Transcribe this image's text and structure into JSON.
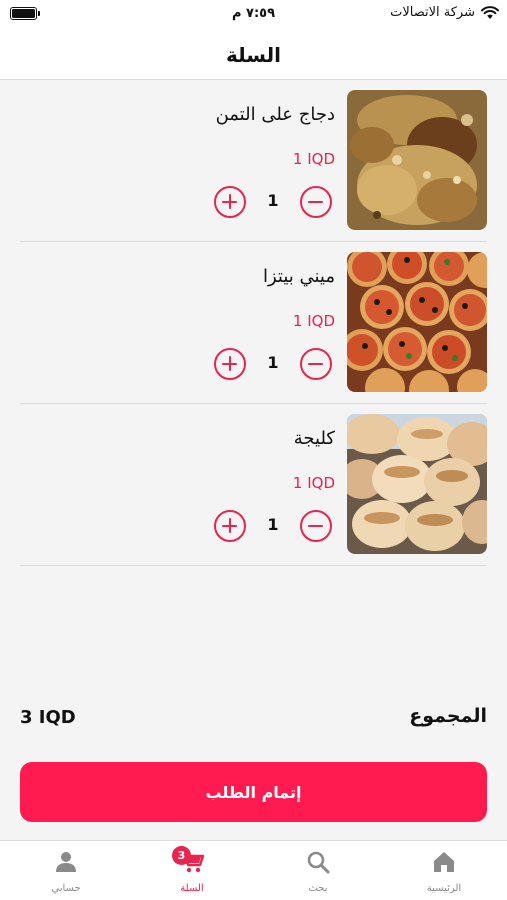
{
  "status_bar": {
    "carrier": "شركة الاتصالات",
    "time": "٧:٥٩ م"
  },
  "header": {
    "title": "السلة"
  },
  "cart": {
    "items": [
      {
        "name": "دجاج على التمن",
        "price": "1 IQD",
        "quantity": "1",
        "image": "chicken-rice-photo"
      },
      {
        "name": "ميني بيتزا",
        "price": "1 IQD",
        "quantity": "1",
        "image": "mini-pizza-photo"
      },
      {
        "name": "كليجة",
        "price": "1 IQD",
        "quantity": "1",
        "image": "kleicha-photo"
      }
    ],
    "total_label": "المجموع",
    "total_value": "3 IQD",
    "checkout_label": "إتمام الطلب"
  },
  "nav": {
    "items": [
      {
        "label": "الرئيسية",
        "icon": "home-icon",
        "active": false
      },
      {
        "label": "بحث",
        "icon": "search-icon",
        "active": false
      },
      {
        "label": "السلة",
        "icon": "cart-icon",
        "active": true,
        "badge": "3"
      },
      {
        "label": "حسابي",
        "icon": "user-icon",
        "active": false
      }
    ]
  },
  "colors": {
    "accent": "#e8244f",
    "button": "#ff1a4f",
    "background": "#f4f4f4"
  }
}
